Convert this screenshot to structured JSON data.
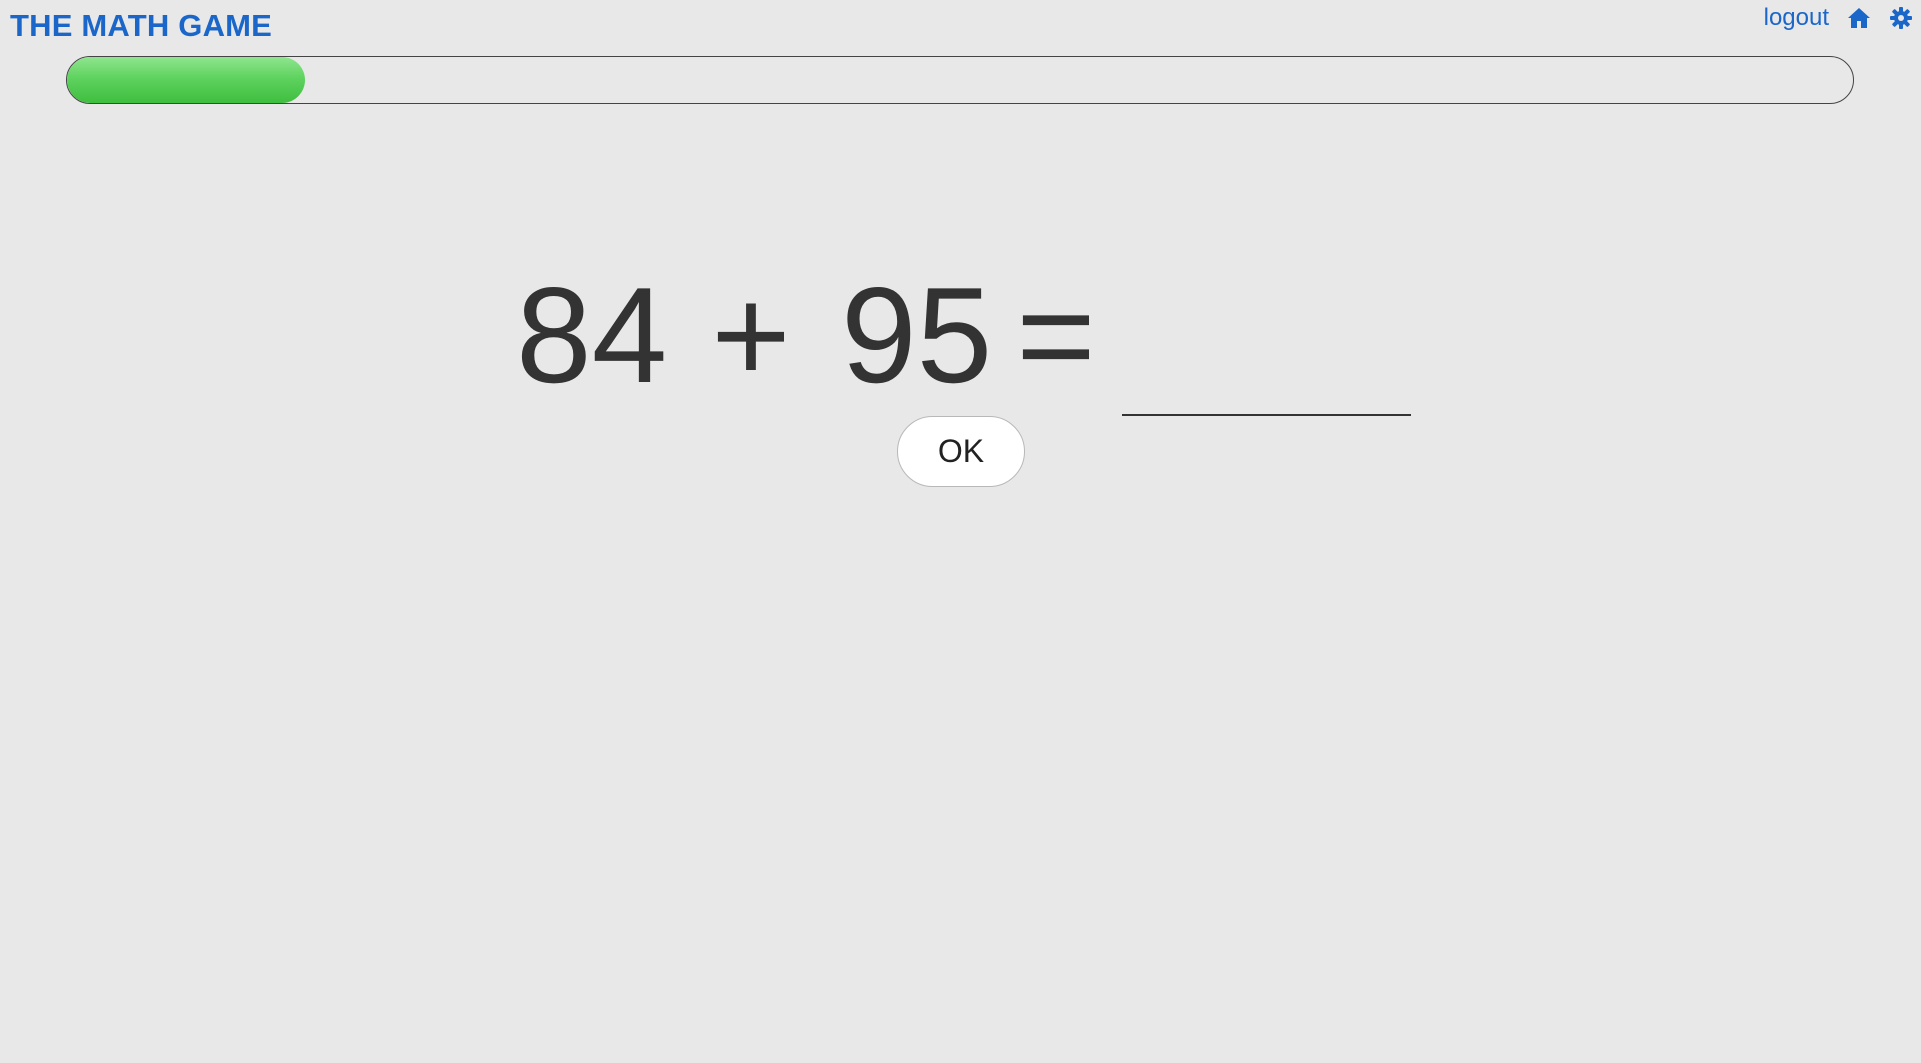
{
  "header": {
    "title": "THE MATH GAME",
    "logout_label": "logout",
    "home_icon": "home-icon",
    "settings_icon": "gear-icon"
  },
  "progress": {
    "fraction": 0.133,
    "fill_color": "#5fd35f"
  },
  "problem": {
    "operand1": "84",
    "operator": "+",
    "operand2": "95",
    "equals": "=",
    "answer_value": ""
  },
  "actions": {
    "ok_label": "OK"
  },
  "colors": {
    "brand": "#1a67c9",
    "background": "#e8e8e8",
    "text": "#333333"
  }
}
